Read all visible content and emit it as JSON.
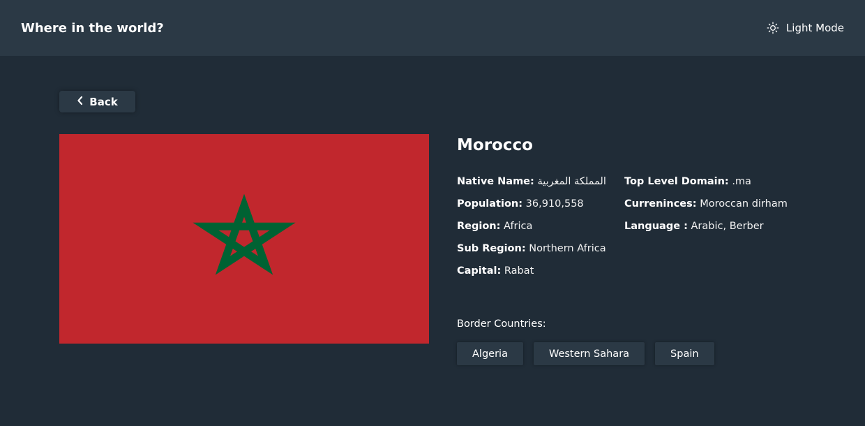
{
  "header": {
    "title": "Where in the world?",
    "mode_label": "Light Mode",
    "mode_icon": "sun-icon"
  },
  "back": {
    "label": "Back",
    "icon": "chevron-left-icon"
  },
  "country": {
    "name": "Morocco",
    "flag": {
      "field_color": "#c1272d",
      "star_color": "#006233",
      "icon": "pentagram-star"
    },
    "left_info": [
      {
        "key": "Native Name:",
        "value": "المملكة المغربية"
      },
      {
        "key": "Population:",
        "value": "36,910,558"
      },
      {
        "key": "Region:",
        "value": "Africa"
      },
      {
        "key": "Sub Region:",
        "value": "Northern Africa"
      },
      {
        "key": "Capital:",
        "value": "Rabat"
      }
    ],
    "right_info": [
      {
        "key": "Top Level Domain:",
        "value": ".ma"
      },
      {
        "key": "Curreninces:",
        "value": "Moroccan dirham"
      },
      {
        "key": "Language :",
        "value": "Arabic, Berber"
      }
    ],
    "border_label": "Border Countries:",
    "borders": [
      "Algeria",
      "Western Sahara",
      "Spain"
    ]
  },
  "colors": {
    "background": "#202c37",
    "surface": "#2b3945",
    "text": "#ffffff"
  }
}
